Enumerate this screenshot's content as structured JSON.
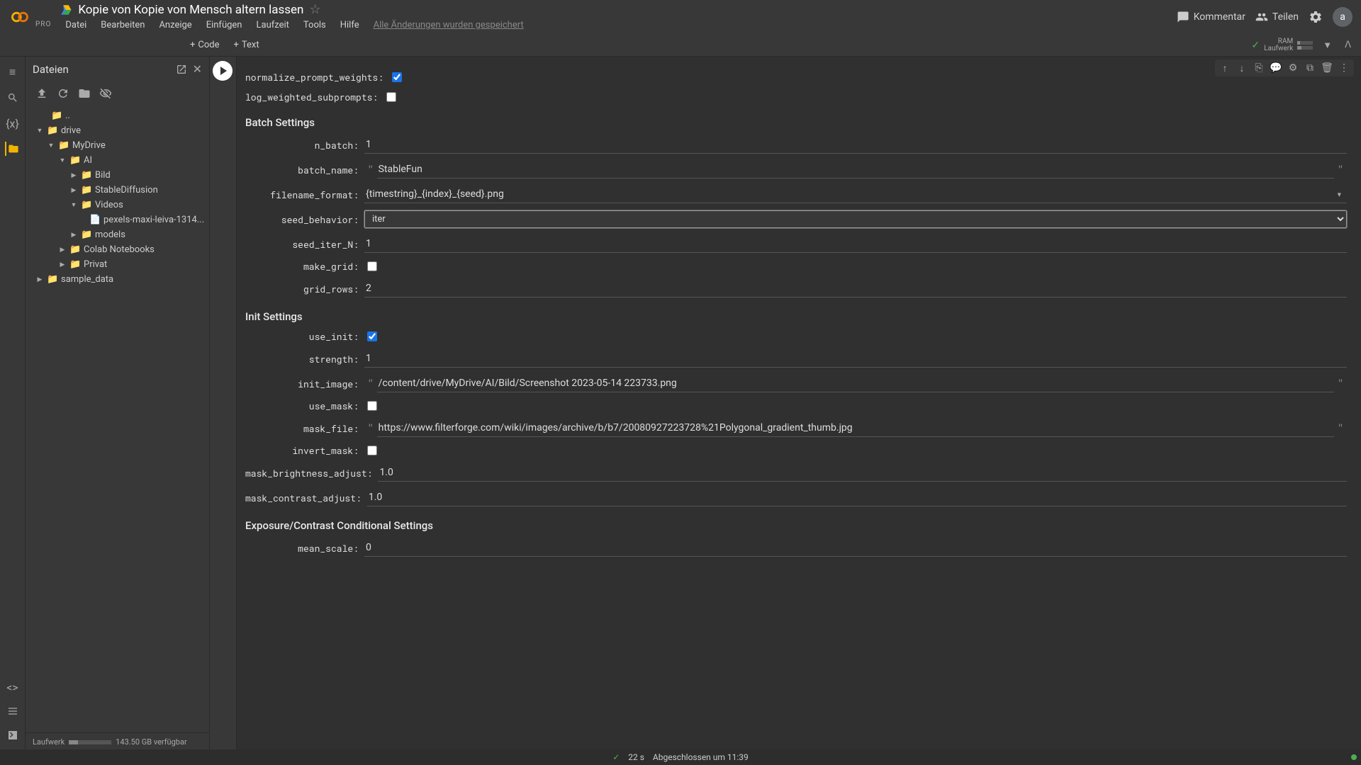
{
  "header": {
    "pro": "PRO",
    "doc_title": "Kopie von Kopie von Mensch altern lassen",
    "menu": [
      "Datei",
      "Bearbeiten",
      "Anzeige",
      "Einfügen",
      "Laufzeit",
      "Tools",
      "Hilfe"
    ],
    "save_status": "Alle Änderungen wurden gespeichert",
    "comment": "Kommentar",
    "share": "Teilen",
    "avatar": "a"
  },
  "toolbar": {
    "code": "Code",
    "text": "Text",
    "ram": "RAM",
    "disk": "Laufwerk"
  },
  "sidebar": {
    "title": "Dateien",
    "tree": {
      "dotdot": "..",
      "drive": "drive",
      "mydrive": "MyDrive",
      "ai": "AI",
      "bild": "Bild",
      "stablediffusion": "StableDiffusion",
      "videos": "Videos",
      "video_file": "pexels-maxi-leiva-1314...",
      "models": "models",
      "colab": "Colab Notebooks",
      "privat": "Privat",
      "sample": "sample_data"
    },
    "footer_label": "Laufwerk",
    "footer_space": "143.50 GB verfügbar"
  },
  "form": {
    "normalize_prompt_weights": {
      "label": "normalize_prompt_weights:",
      "checked": true
    },
    "log_weighted_subprompts": {
      "label": "log_weighted_subprompts:",
      "checked": false
    },
    "section_batch": "Batch Settings",
    "n_batch": {
      "label": "n_batch:",
      "value": "1"
    },
    "batch_name": {
      "label": "batch_name:",
      "value": "StableFun"
    },
    "filename_format": {
      "label": "filename_format:",
      "value": "{timestring}_{index}_{seed}.png"
    },
    "seed_behavior": {
      "label": "seed_behavior:",
      "value": "iter"
    },
    "seed_iter_N": {
      "label": "seed_iter_N:",
      "value": "1"
    },
    "make_grid": {
      "label": "make_grid:",
      "checked": false
    },
    "grid_rows": {
      "label": "grid_rows:",
      "value": "2"
    },
    "section_init": "Init Settings",
    "use_init": {
      "label": "use_init:",
      "checked": true
    },
    "strength": {
      "label": "strength:",
      "value": "1"
    },
    "init_image": {
      "label": "init_image:",
      "value": "/content/drive/MyDrive/AI/Bild/Screenshot 2023-05-14 223733.png"
    },
    "use_mask": {
      "label": "use_mask:",
      "checked": false
    },
    "mask_file": {
      "label": "mask_file:",
      "value": "https://www.filterforge.com/wiki/images/archive/b/b7/20080927223728%21Polygonal_gradient_thumb.jpg"
    },
    "invert_mask": {
      "label": "invert_mask:",
      "checked": false
    },
    "mask_brightness_adjust": {
      "label": "mask_brightness_adjust:",
      "value": "1.0"
    },
    "mask_contrast_adjust": {
      "label": "mask_contrast_adjust:",
      "value": "1.0"
    },
    "section_exposure": "Exposure/Contrast Conditional Settings",
    "mean_scale": {
      "label": "mean_scale:",
      "value": "0"
    }
  },
  "status": {
    "time": "22 s",
    "msg": "Abgeschlossen um 11:39"
  }
}
